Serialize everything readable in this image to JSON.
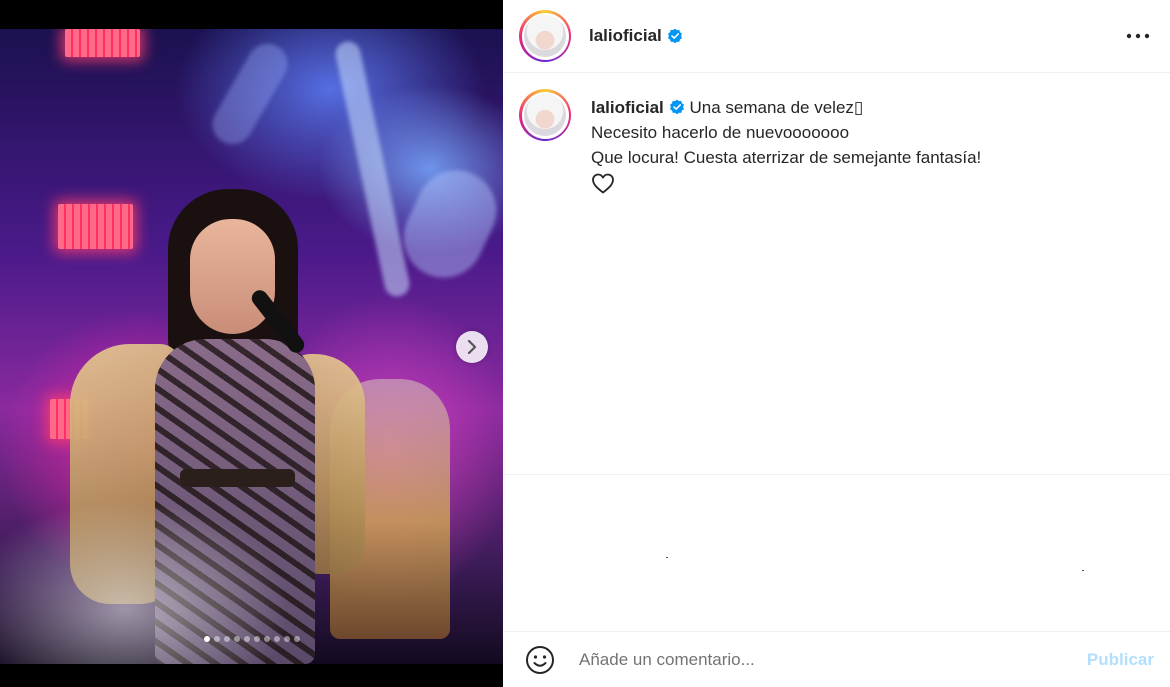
{
  "post": {
    "author": {
      "username": "lalioficial",
      "verified": true
    },
    "media": {
      "slide_count": 10,
      "active_slide": 1
    },
    "caption": {
      "username": "lalioficial",
      "lines": [
        "Una semana de velez▯",
        "Necesito hacerlo de nuevooooooo",
        "Que locura! Cuesta aterrizar de semejante fantasía!"
      ]
    },
    "comment": {
      "placeholder": "Añade un comentario...",
      "publish_label": "Publicar"
    },
    "icons": {
      "verified": "verified-badge-icon",
      "more": "more-options-icon",
      "like": "heart-icon",
      "emoji": "emoji-icon",
      "next": "chevron-right-icon"
    },
    "colors": {
      "verified": "#0095f6",
      "publish_disabled": "#b2dffc",
      "text": "#262626"
    }
  }
}
